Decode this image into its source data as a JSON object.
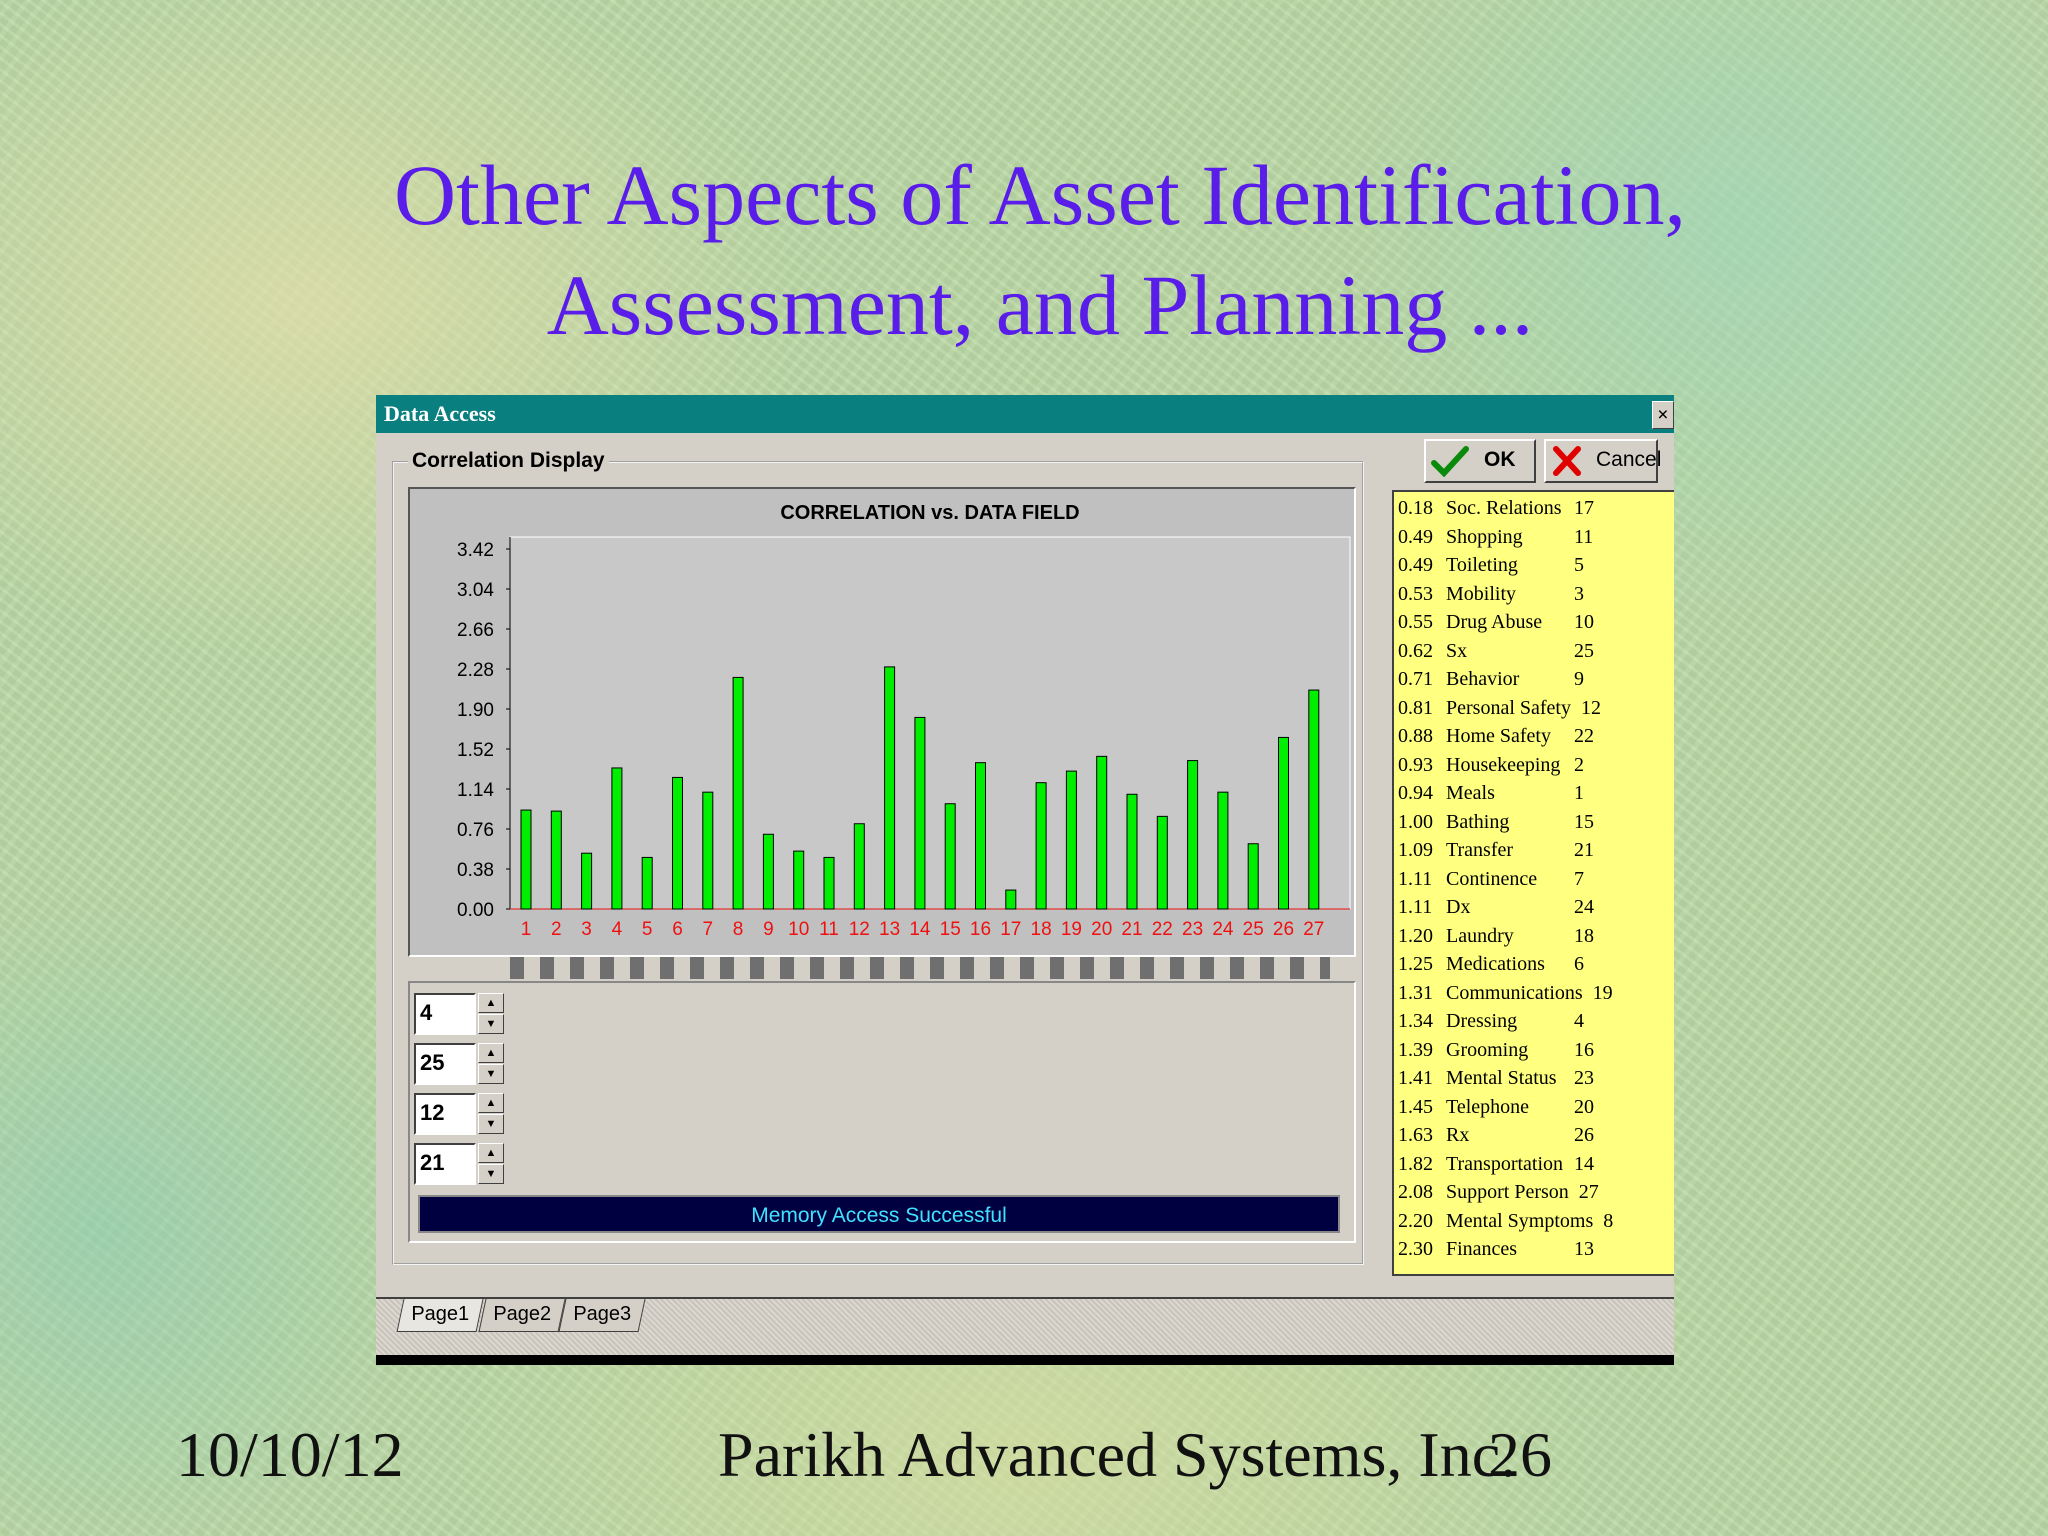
{
  "slide": {
    "title_line1": "Other Aspects of Asset Identification,",
    "title_line2": "Assessment, and Planning ...",
    "footer_date": "10/10/12",
    "footer_company": "Parikh Advanced Systems, Inc.",
    "page_number": "26"
  },
  "dialog": {
    "title": "Data Access",
    "close_glyph": "×",
    "ok_label": "OK",
    "cancel_label": "Cancel",
    "group_label": "Correlation Display",
    "status_text": "Memory Access Successful",
    "spinners": [
      "4",
      "25",
      "12",
      "21"
    ],
    "tabs": [
      "Page1",
      "Page2",
      "Page3"
    ],
    "spinner_up_glyph": "▲",
    "spinner_down_glyph": "▼"
  },
  "correlation_list": [
    {
      "value": "0.18",
      "name": "Soc. Relations",
      "field": "17"
    },
    {
      "value": "0.49",
      "name": "Shopping",
      "field": "11"
    },
    {
      "value": "0.49",
      "name": "Toileting",
      "field": "5"
    },
    {
      "value": "0.53",
      "name": "Mobility",
      "field": "3"
    },
    {
      "value": "0.55",
      "name": "Drug Abuse",
      "field": "10"
    },
    {
      "value": "0.62",
      "name": "Sx",
      "field": "25"
    },
    {
      "value": "0.71",
      "name": "Behavior",
      "field": "9"
    },
    {
      "value": "0.81",
      "name": "Personal Safety",
      "field": "12"
    },
    {
      "value": "0.88",
      "name": "Home Safety",
      "field": "22"
    },
    {
      "value": "0.93",
      "name": "Housekeeping",
      "field": "2"
    },
    {
      "value": "0.94",
      "name": "Meals",
      "field": "1"
    },
    {
      "value": "1.00",
      "name": "Bathing",
      "field": "15"
    },
    {
      "value": "1.09",
      "name": "Transfer",
      "field": "21"
    },
    {
      "value": "1.11",
      "name": "Continence",
      "field": "7"
    },
    {
      "value": "1.11",
      "name": "Dx",
      "field": "24"
    },
    {
      "value": "1.20",
      "name": "Laundry",
      "field": "18"
    },
    {
      "value": "1.25",
      "name": "Medications",
      "field": "6"
    },
    {
      "value": "1.31",
      "name": "Communications",
      "field": "19"
    },
    {
      "value": "1.34",
      "name": "Dressing",
      "field": "4"
    },
    {
      "value": "1.39",
      "name": "Grooming",
      "field": "16"
    },
    {
      "value": "1.41",
      "name": "Mental Status",
      "field": "23"
    },
    {
      "value": "1.45",
      "name": "Telephone",
      "field": "20"
    },
    {
      "value": "1.63",
      "name": "Rx",
      "field": "26"
    },
    {
      "value": "1.82",
      "name": "Transportation",
      "field": "14"
    },
    {
      "value": "2.08",
      "name": "Support Person",
      "field": "27"
    },
    {
      "value": "2.20",
      "name": "Mental Symptoms",
      "field": "8"
    },
    {
      "value": "2.30",
      "name": "Finances",
      "field": "13"
    }
  ],
  "chart_data": {
    "type": "bar",
    "title": "CORRELATION vs. DATA FIELD",
    "categories": [
      "1",
      "2",
      "3",
      "4",
      "5",
      "6",
      "7",
      "8",
      "9",
      "10",
      "11",
      "12",
      "13",
      "14",
      "15",
      "16",
      "17",
      "18",
      "19",
      "20",
      "21",
      "22",
      "23",
      "24",
      "25",
      "26",
      "27"
    ],
    "values": [
      0.94,
      0.93,
      0.53,
      1.34,
      0.49,
      1.25,
      1.11,
      2.2,
      0.71,
      0.55,
      0.49,
      0.81,
      2.3,
      1.82,
      1.0,
      1.39,
      0.18,
      1.2,
      1.31,
      1.45,
      1.09,
      0.88,
      1.41,
      1.11,
      0.62,
      1.63,
      2.08
    ],
    "yticks": [
      "3.42",
      "3.04",
      "2.66",
      "2.28",
      "1.90",
      "1.52",
      "1.14",
      "0.76",
      "0.38",
      "0.00"
    ],
    "ylim": [
      0,
      3.42
    ],
    "bar_color": "#00ee00",
    "tick_label_color": "#ee1111",
    "plot_bg": "#c8c8c8",
    "grid": false
  }
}
